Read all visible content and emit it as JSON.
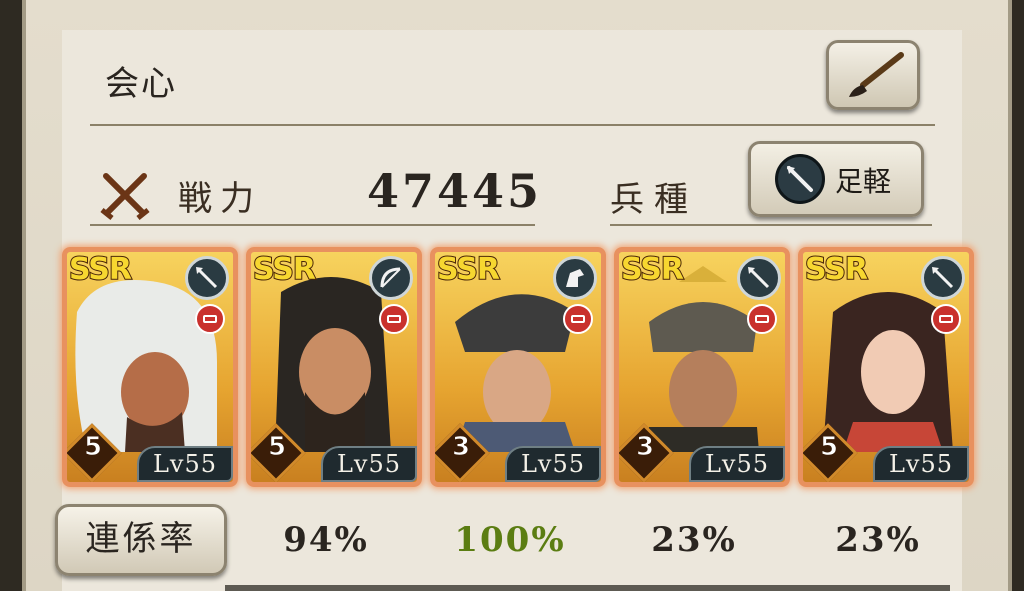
{
  "team": {
    "name": "会心",
    "power_label": "戦力",
    "power_value": "47445",
    "troop_type_label": "兵種",
    "troop_type_value": "足軽",
    "edit_icon": "brush-icon",
    "power_icon": "crossed-swords-icon"
  },
  "cards": [
    {
      "rarity": "SSR",
      "unit_icon": "spear-icon",
      "rank": "5",
      "level": "Lv55"
    },
    {
      "rarity": "SSR",
      "unit_icon": "bow-icon",
      "rank": "5",
      "level": "Lv55"
    },
    {
      "rarity": "SSR",
      "unit_icon": "horse-icon",
      "rank": "3",
      "level": "Lv55"
    },
    {
      "rarity": "SSR",
      "unit_icon": "spear-icon",
      "rank": "3",
      "level": "Lv55"
    },
    {
      "rarity": "SSR",
      "unit_icon": "spear-icon",
      "rank": "5",
      "level": "Lv55"
    }
  ],
  "link_rate": {
    "label": "連係率",
    "values": [
      "94%",
      "100%",
      "23%",
      "23%"
    ],
    "colors": [
      "#2a2520",
      "#5b7d12",
      "#2a2520",
      "#2a2520"
    ]
  },
  "colors": {
    "card_border": "#e8915f",
    "card_gold": "#f7d35e",
    "ssr_text": "#f7d730",
    "highlight_green": "#5b7d12"
  }
}
